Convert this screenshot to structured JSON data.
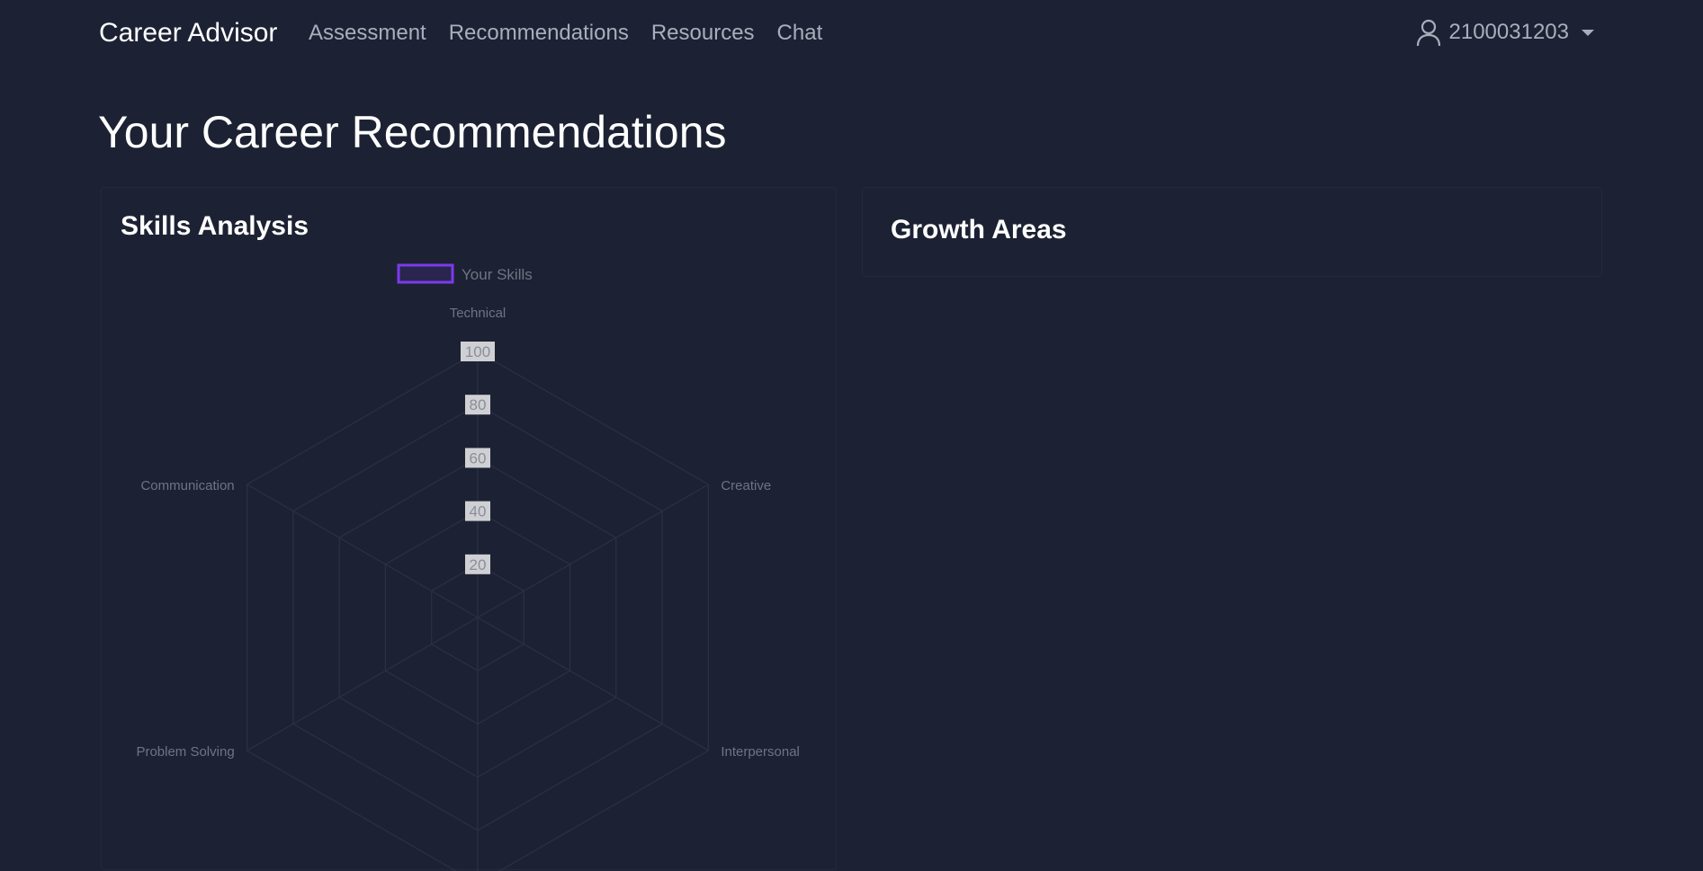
{
  "navbar": {
    "brand": "Career Advisor",
    "links": [
      "Assessment",
      "Recommendations",
      "Resources",
      "Chat"
    ],
    "user": {
      "id": "2100031203",
      "icon": "user-icon"
    }
  },
  "page": {
    "title": "Your Career Recommendations"
  },
  "skills_card": {
    "title": "Skills Analysis"
  },
  "growth_card": {
    "title": "Growth Areas"
  },
  "colors": {
    "accent": "#7c3aed",
    "background": "#1c2233",
    "muted_text": "#a9aebb"
  },
  "chart_data": {
    "type": "radar",
    "axes": [
      "Technical",
      "Creative",
      "Interpersonal",
      "",
      "Problem Solving",
      "Communication"
    ],
    "ticks": [
      20,
      40,
      60,
      80,
      100
    ],
    "r_range": [
      0,
      100
    ],
    "series": [
      {
        "name": "Your Skills",
        "values": [
          0,
          0,
          0,
          0,
          0,
          0
        ],
        "color": "#7c3aed"
      }
    ],
    "legend": "top-center"
  }
}
